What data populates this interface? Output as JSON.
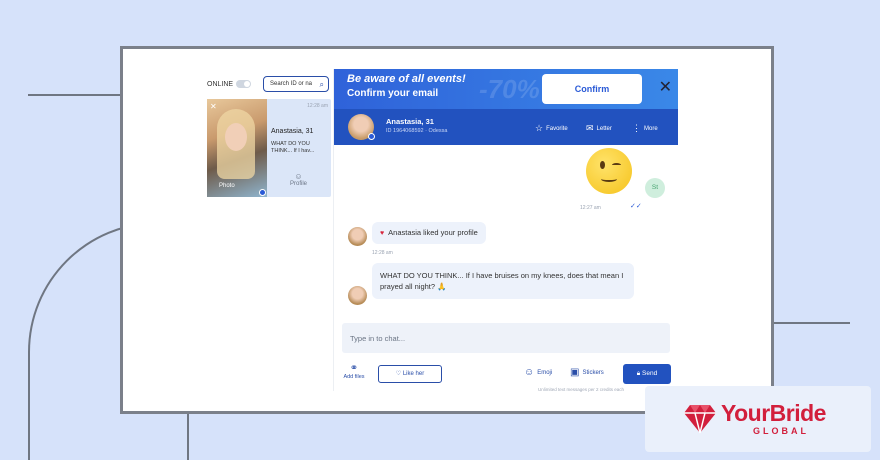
{
  "left_panel": {
    "online_label": "ONLINE",
    "search_placeholder": "Search ID or na",
    "card": {
      "time": "12:28 am",
      "name": "Anastasia, 31",
      "preview": "WHAT DO YOU THINK... If I hav...",
      "photo_label": "Photo",
      "profile_label": "Profile"
    }
  },
  "banner": {
    "line1": "Be aware of all events!",
    "line2": "Confirm your email",
    "background_text": "-70%",
    "confirm_label": "Confirm"
  },
  "chat_header": {
    "name": "Anastasia, 31",
    "id_line": "ID 1964068592  ·  Odessa",
    "favorite_label": "Favorite",
    "letter_label": "Letter",
    "more_label": "More"
  },
  "messages": {
    "outgoing": {
      "avatar_text": "St",
      "time": "12:27 am"
    },
    "like": {
      "text": "Anastasia liked your profile",
      "time": "12:28 am"
    },
    "incoming": {
      "text": "WHAT DO YOU THINK... If I have bruises on my knees, does that mean I prayed all night? 🙏"
    }
  },
  "composer": {
    "placeholder": "Type in to chat...",
    "add_files_label": "Add files",
    "like_label": "Like her",
    "emoji_label": "Emoji",
    "stickers_label": "Stickers",
    "send_label": "Send",
    "credits_note": "Unlimited text messages per 2 credits each"
  },
  "logo": {
    "brand": "YourBride",
    "sub": "GLOBAL"
  },
  "colors": {
    "accent": "#2252bf",
    "banner": "#2f62d9",
    "brand_red": "#d21f3c"
  }
}
